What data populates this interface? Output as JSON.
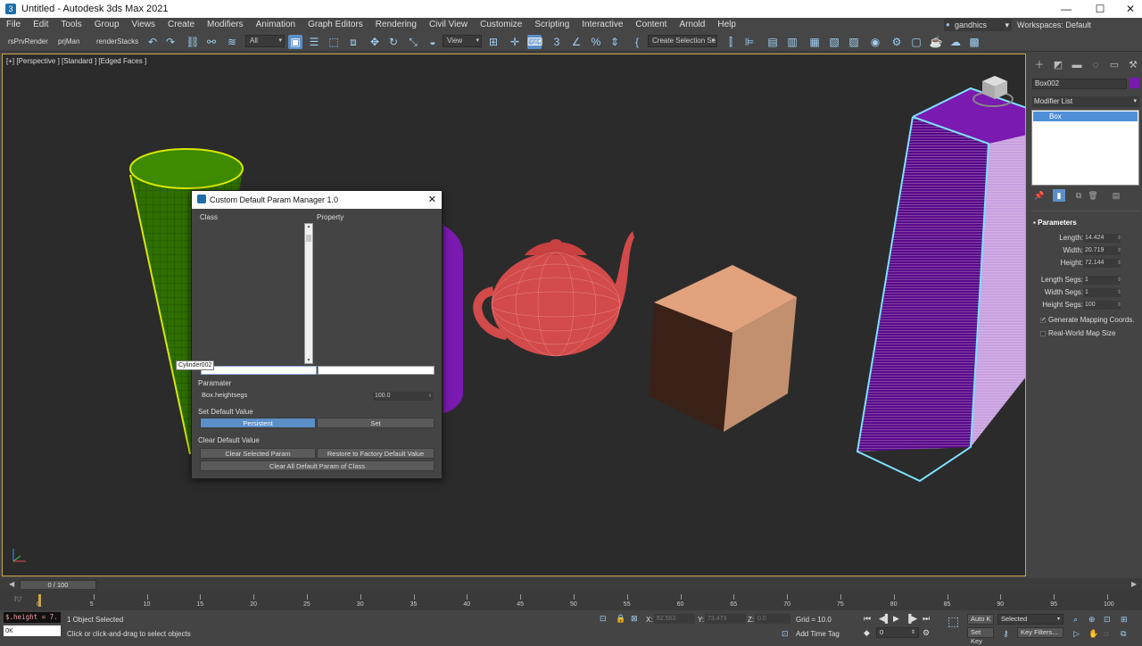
{
  "window": {
    "title": "Untitled - Autodesk 3ds Max 2021",
    "minimize": "—",
    "maximize": "☐",
    "close": "✕"
  },
  "menu": [
    "File",
    "Edit",
    "Tools",
    "Group",
    "Views",
    "Create",
    "Modifiers",
    "Animation",
    "Graph Editors",
    "Rendering",
    "Civil View",
    "Customize",
    "Scripting",
    "Interactive",
    "Content",
    "Arnold",
    "Help"
  ],
  "user": {
    "name": "gandhics",
    "workspaces": "Workspaces:  Default"
  },
  "toolbar": {
    "rsPrvRender": "rsPrvRender",
    "prjMan": "prjMan",
    "renderStacks": "renderStacks",
    "filter": "All",
    "refcoord": "View",
    "selection_set": "Create Selection Se"
  },
  "viewport": {
    "label": "[+] [Perspective ] [Standard ] [Edged Faces ]"
  },
  "command_panel": {
    "object_name": "Box002",
    "object_color": "#7a1ab0",
    "modifier_list": "Modifier List",
    "stack_item": "Box",
    "rollout": "Parameters",
    "params": [
      {
        "label": "Length:",
        "value": "14.424"
      },
      {
        "label": "Width:",
        "value": "20.719"
      },
      {
        "label": "Height:",
        "value": "72.144"
      },
      {
        "label": "Length Segs:",
        "value": "1"
      },
      {
        "label": "Width Segs:",
        "value": "1"
      },
      {
        "label": "Height Segs:",
        "value": "100"
      }
    ],
    "gen_mapping": "Generate Mapping Coords.",
    "real_world": "Real-World Map Size"
  },
  "dialog": {
    "title": "Custom Default Param Manager 1.0",
    "col_class": "Class",
    "col_property": "Property",
    "tooltip": "Cylinder002",
    "paramater_label": "Paramater",
    "param_name": "Box.heightsegs",
    "param_value": "100.0",
    "set_default_label": "Set Default Value",
    "persistent": "Persistent",
    "set": "Set",
    "clear_default_label": "Clear Default Value",
    "clear_selected": "Clear Selected Param",
    "restore_factory": "Restore to Factory Default Value",
    "clear_all": "Clear All Default Param of Class"
  },
  "timeline": {
    "slider": "0 / 100",
    "ticks": [
      "0",
      "5",
      "10",
      "15",
      "20",
      "25",
      "30",
      "35",
      "40",
      "45",
      "50",
      "55",
      "60",
      "65",
      "70",
      "75",
      "80",
      "85",
      "90",
      "95",
      "100"
    ]
  },
  "status": {
    "script_line": "$.height = 7.",
    "script_result": "OK",
    "selected": "1 Object Selected",
    "prompt": "Click or click-and-drag to select objects",
    "x_label": "X:",
    "x_value": "62.563",
    "y_label": "Y:",
    "y_value": "73.473",
    "z_label": "Z:",
    "z_value": "0.0",
    "grid": "Grid = 10.0",
    "add_time_tag": "Add Time Tag",
    "frame": "0",
    "auto_key": "Auto K",
    "set_key": "Set Key",
    "selected_dd": "Selected",
    "key_filters": "Key Filters..."
  }
}
